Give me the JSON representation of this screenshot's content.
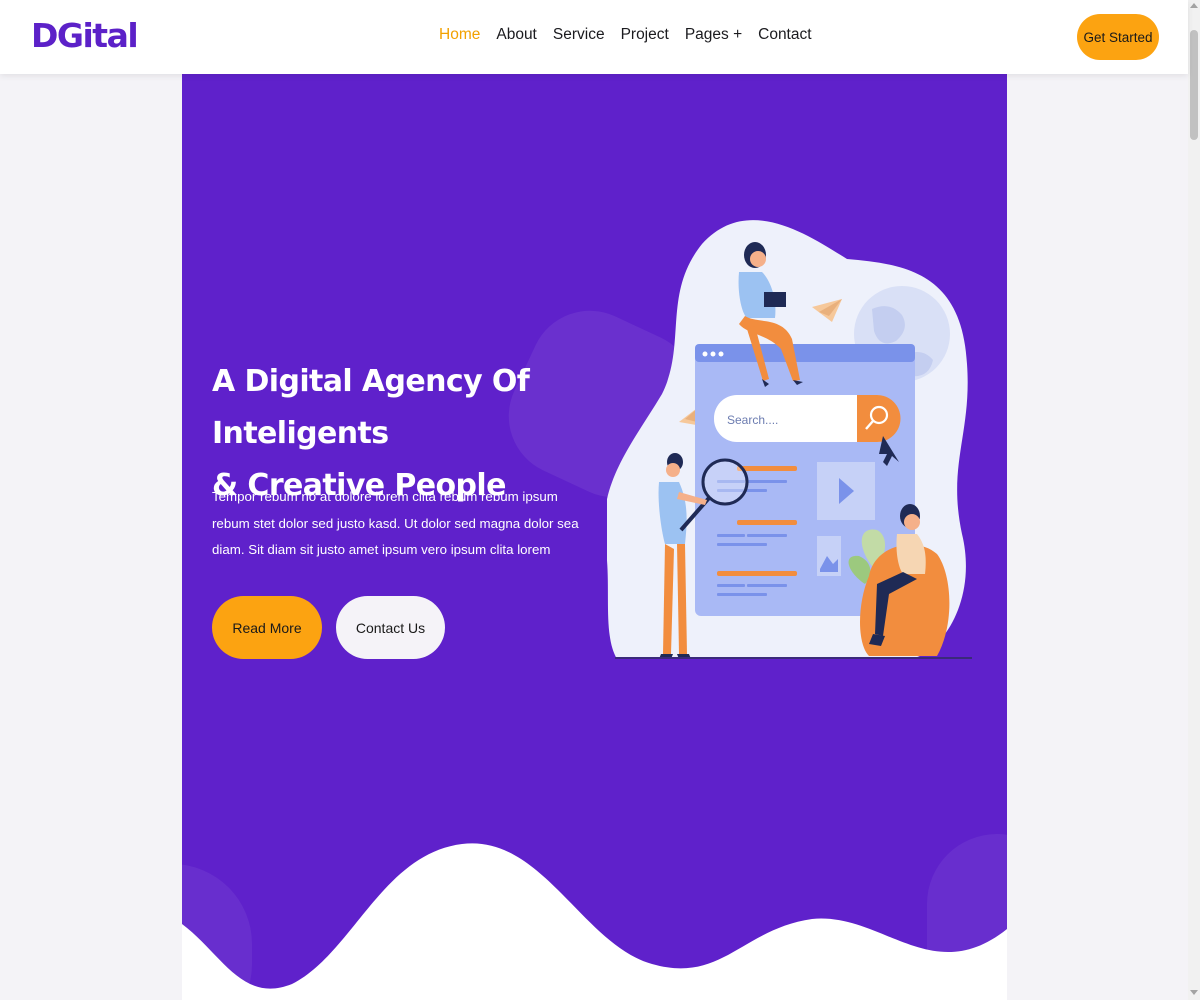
{
  "brand": {
    "logo": "DGital"
  },
  "nav": {
    "links": [
      {
        "label": "Home",
        "active": true
      },
      {
        "label": "About"
      },
      {
        "label": "Service"
      },
      {
        "label": "Project"
      },
      {
        "label": "Pages +"
      },
      {
        "label": "Contact"
      }
    ],
    "cta_label": "Get Started"
  },
  "hero": {
    "title_line1": "A Digital Agency Of Inteligents",
    "title_line2": "& Creative People",
    "text": "Tempor rebum no at dolore lorem clita rebum rebum ipsum rebum stet dolor sed justo kasd. Ut dolor sed magna dolor sea diam. Sit diam sit justo amet ipsum vero ipsum clita lorem",
    "read_more_label": "Read More",
    "contact_label": "Contact Us",
    "illustration": {
      "search_placeholder": "Search...."
    }
  },
  "colors": {
    "primary": "#5f21cb",
    "accent": "#fca311",
    "nav_active": "#f2a100",
    "text_dark": "#1b1b1f",
    "white": "#ffffff"
  },
  "icons": [
    "search-icon",
    "play-icon",
    "image-icon",
    "globe-icon",
    "paper-plane-icon",
    "magnifier-icon",
    "cursor-icon",
    "laptop-icon"
  ]
}
